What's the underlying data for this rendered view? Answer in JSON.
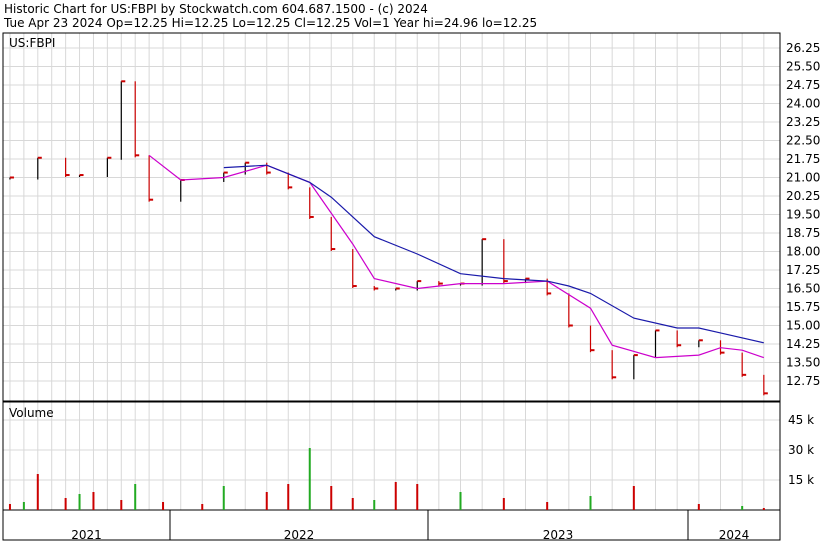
{
  "header": {
    "line1": "Historic Chart for US:FBPI by Stockwatch.com 604.687.1500 - (c) 2024",
    "line2": "Tue Apr 23 2024  Op=12.25  Hi=12.25  Lo=12.25  Cl=12.25  Vol=1  Year hi=24.96  lo=12.25"
  },
  "colors": {
    "price_bar": "#cc0000",
    "price_bar_up": "#000000",
    "ma_short": "#cc00cc",
    "ma_long": "#1a1aaa",
    "volume_down": "#cc0000",
    "volume_up": "#22aa22",
    "grid": "#d8d8d8",
    "frame": "#000000"
  },
  "chart_data": [
    {
      "type": "line",
      "title": "US:FBPI",
      "ylim": [
        12.0,
        26.6
      ],
      "y_ticks": [
        "26.25",
        "25.50",
        "24.75",
        "24.00",
        "23.25",
        "22.50",
        "21.75",
        "21.00",
        "20.25",
        "19.50",
        "18.75",
        "18.00",
        "17.25",
        "16.50",
        "15.75",
        "15.00",
        "14.25",
        "13.50",
        "12.75"
      ],
      "x_labels": [
        "2021",
        "2022",
        "2023",
        "2024"
      ],
      "grid": true,
      "price_series": {
        "name": "",
        "x": [
          "2021-01",
          "2021-03",
          "2021-05",
          "2021-06",
          "2021-08",
          "2021-09",
          "2021-10",
          "2021-11",
          "2022-01",
          "2022-03",
          "2022-04",
          "2022-05",
          "2022-06",
          "2022-07",
          "2022-08",
          "2022-09",
          "2022-10",
          "2022-11",
          "2022-12",
          "2023-01",
          "2023-02",
          "2023-03",
          "2023-04",
          "2023-05",
          "2023-06",
          "2023-07",
          "2023-08",
          "2023-09",
          "2023-10",
          "2023-11",
          "2023-12",
          "2024-01",
          "2024-02",
          "2024-03",
          "2024-04"
        ],
        "values": [
          21.0,
          21.8,
          21.1,
          21.1,
          21.8,
          24.9,
          21.9,
          20.1,
          20.9,
          21.2,
          21.6,
          21.2,
          20.6,
          19.4,
          18.1,
          16.6,
          16.5,
          16.5,
          16.8,
          16.7,
          16.7,
          18.5,
          16.8,
          16.9,
          16.3,
          15.0,
          14.0,
          12.9,
          13.8,
          14.8,
          14.2,
          14.4,
          13.9,
          13.0,
          12.25
        ]
      },
      "ma_series": [
        {
          "name": "",
          "x": [
            "2021-11",
            "2022-01",
            "2022-03",
            "2022-05",
            "2022-07",
            "2022-09",
            "2022-10",
            "2022-12",
            "2023-02",
            "2023-04",
            "2023-06",
            "2023-08",
            "2023-09",
            "2023-11",
            "2024-01",
            "2024-02",
            "2024-03",
            "2024-04"
          ],
          "values": [
            21.9,
            20.9,
            21.0,
            21.5,
            20.8,
            18.3,
            16.9,
            16.5,
            16.7,
            16.7,
            16.8,
            15.7,
            14.2,
            13.7,
            13.8,
            14.1,
            14.0,
            13.7
          ]
        },
        {
          "name": "",
          "x": [
            "2022-03",
            "2022-05",
            "2022-07",
            "2022-08",
            "2022-10",
            "2022-12",
            "2023-02",
            "2023-04",
            "2023-06",
            "2023-07",
            "2023-08",
            "2023-10",
            "2023-12",
            "2024-01",
            "2024-02",
            "2024-04"
          ],
          "values": [
            21.4,
            21.5,
            20.8,
            20.2,
            18.6,
            17.9,
            17.1,
            16.9,
            16.8,
            16.6,
            16.3,
            15.3,
            14.9,
            14.9,
            14.7,
            14.3
          ]
        }
      ]
    },
    {
      "type": "bar",
      "title": "Volume",
      "ylim": [
        0,
        54000
      ],
      "y_ticks": [
        "45 k",
        "30 k",
        "15 k"
      ],
      "series": [
        {
          "name": "",
          "x": [
            "2021-01",
            "2021-02",
            "2021-03",
            "2021-05",
            "2021-06",
            "2021-07",
            "2021-09",
            "2021-10",
            "2021-12",
            "2022-02",
            "2022-03",
            "2022-05",
            "2022-06",
            "2022-07",
            "2022-08",
            "2022-09",
            "2022-10",
            "2022-11",
            "2022-12",
            "2023-02",
            "2023-04",
            "2023-06",
            "2023-08",
            "2023-10",
            "2024-01",
            "2024-03",
            "2024-04"
          ],
          "values": [
            3000,
            4000,
            18000,
            6000,
            8000,
            9000,
            5000,
            13000,
            4000,
            3000,
            12000,
            9000,
            13000,
            31000,
            12000,
            6000,
            5000,
            14000,
            13000,
            9000,
            6000,
            4000,
            7000,
            12000,
            3000,
            2000,
            1000
          ]
        }
      ]
    }
  ]
}
